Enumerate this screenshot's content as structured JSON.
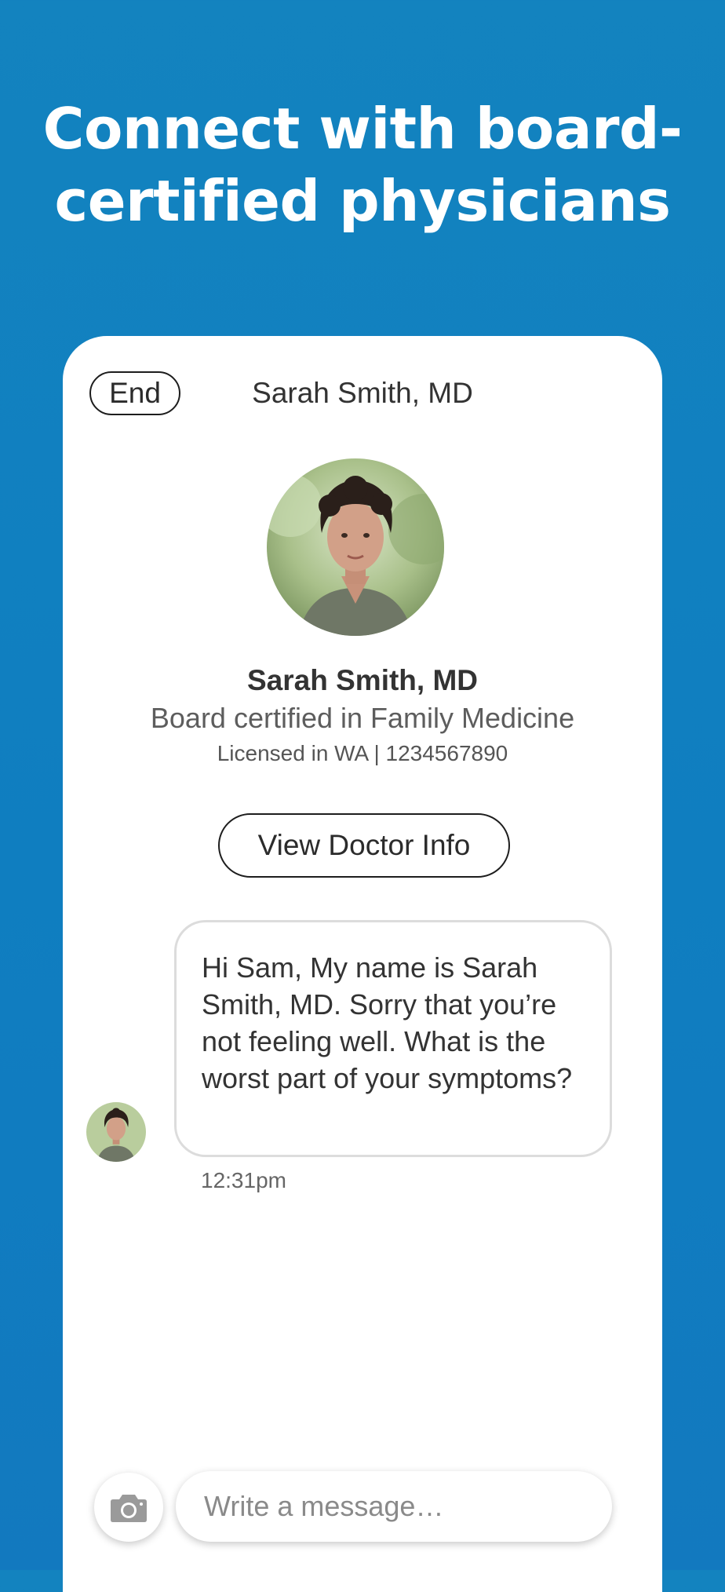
{
  "headline": {
    "line1": "Connect with board-",
    "line2": "certified physicians"
  },
  "header": {
    "end_label": "End",
    "doctor_name": "Sarah Smith, MD"
  },
  "profile": {
    "name": "Sarah Smith, MD",
    "specialty": "Board certified in Family Medicine",
    "license": "Licensed in WA | 1234567890",
    "view_info_label": "View Doctor Info"
  },
  "messages": [
    {
      "text": "Hi Sam, My name is Sarah Smith, MD. Sorry that you’re not feeling well. What is the worst part of your symptoms?",
      "time": "12:31pm"
    }
  ],
  "composer": {
    "placeholder": "Write a message…",
    "camera_icon": "camera-icon"
  },
  "colors": {
    "background": "#1383bf",
    "card": "#ffffff",
    "text": "#333333"
  }
}
